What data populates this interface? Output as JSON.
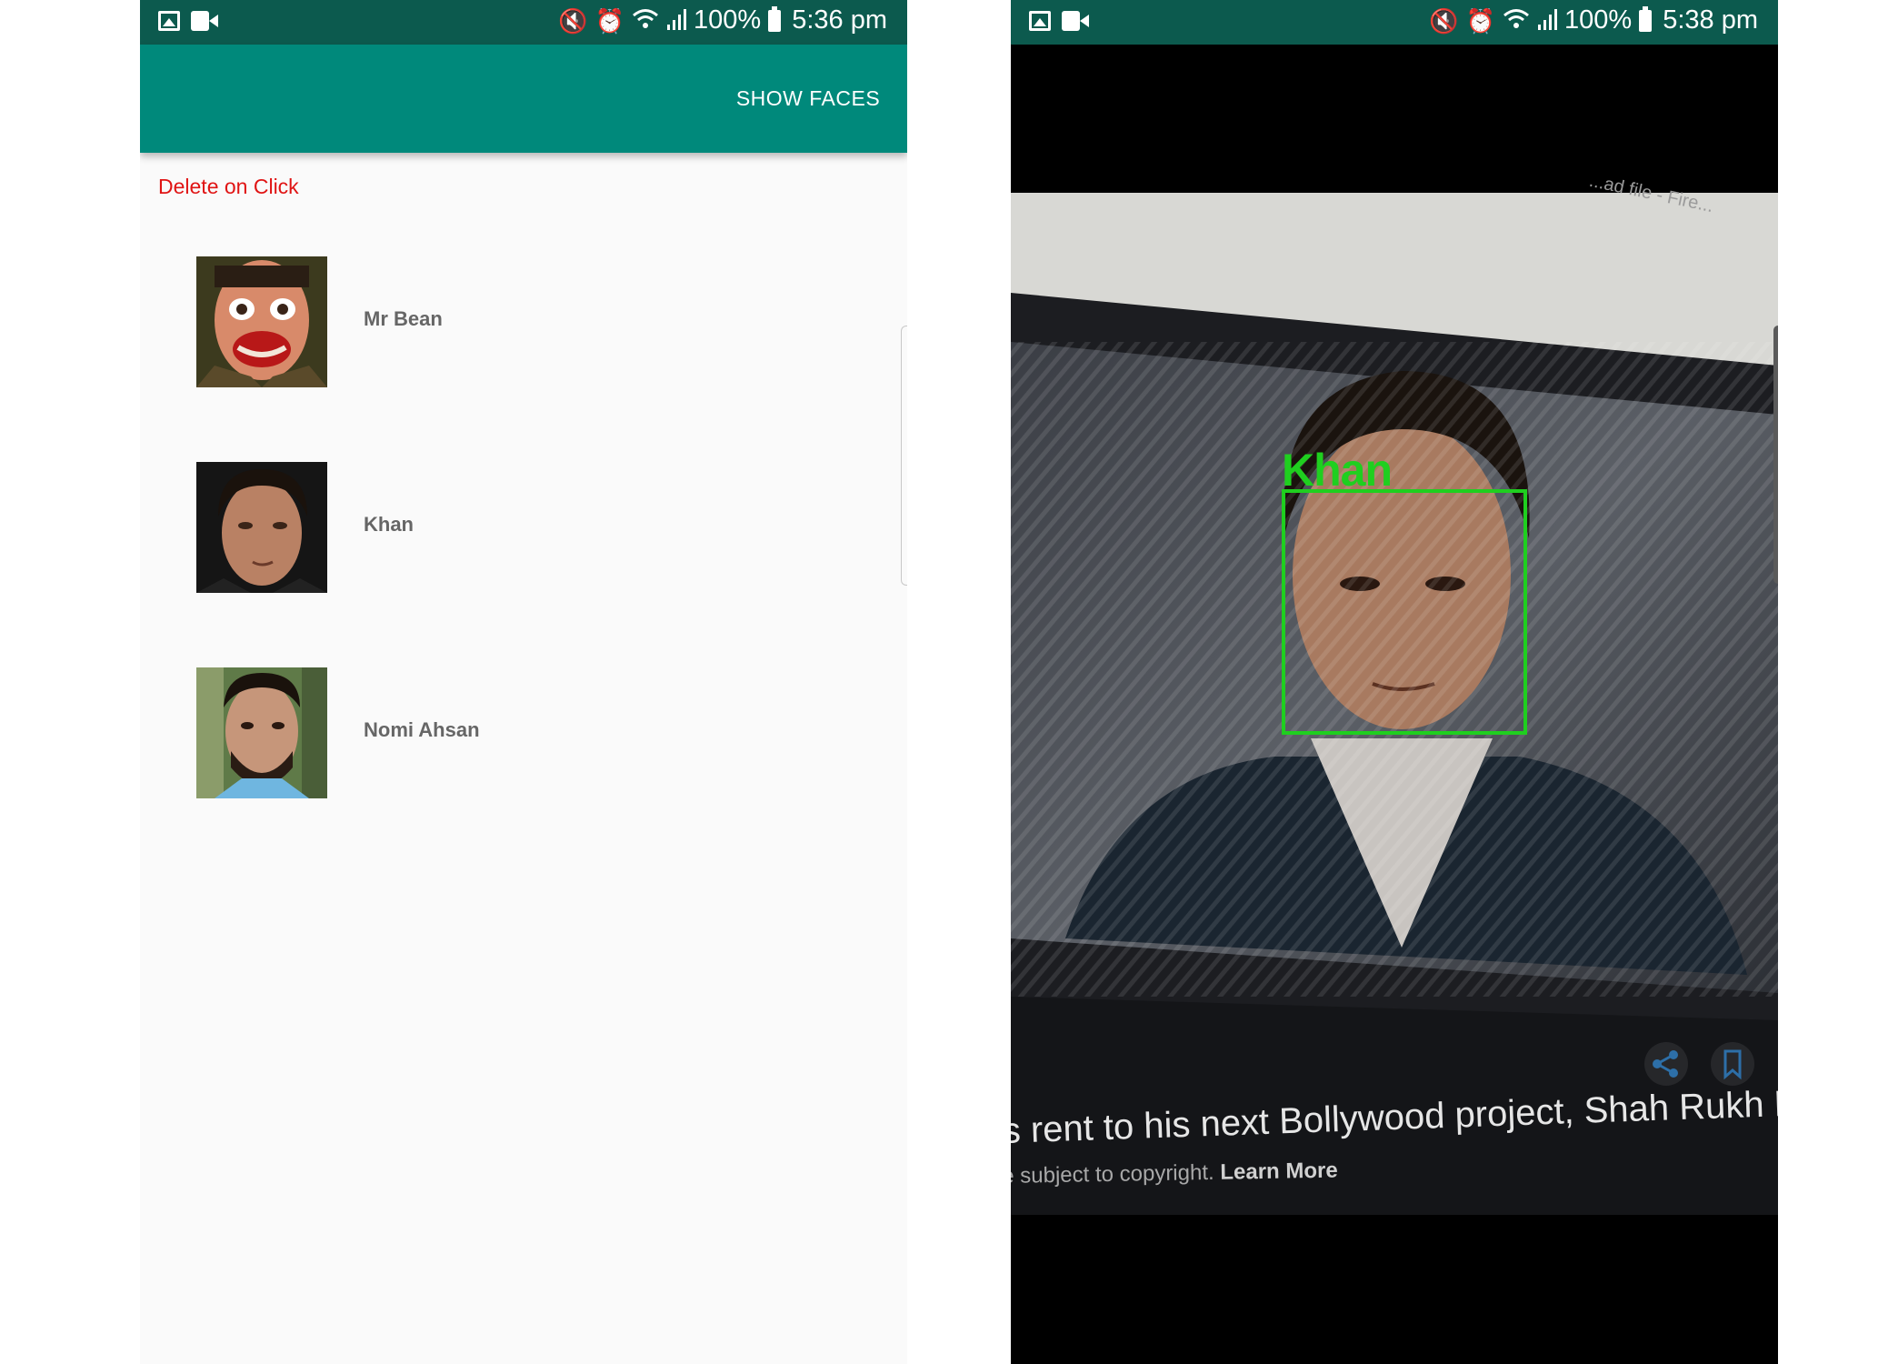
{
  "left_screen": {
    "status_bar": {
      "battery": "100%",
      "time": "5:36 pm"
    },
    "app_bar": {
      "action_label": "SHOW FACES"
    },
    "mode_label": "Delete on Click",
    "faces": [
      {
        "name": "Mr Bean"
      },
      {
        "name": "Khan"
      },
      {
        "name": "Nomi Ahsan"
      }
    ]
  },
  "right_screen": {
    "status_bar": {
      "battery": "100%",
      "time": "5:38 pm"
    },
    "detection": {
      "label": "Khan",
      "box_color": "#1fcf1f"
    },
    "screen_tab_text": "...ad file - Fire...",
    "caption": "s rent to his next Bollywood project, Shah Rukh K",
    "copyright": "e subject to copyright.",
    "learn_more": "Learn More"
  },
  "colors": {
    "status_bar": "#0c5a4e",
    "app_bar": "#00897b",
    "mode_label": "#e01414",
    "face_name": "#666666"
  }
}
